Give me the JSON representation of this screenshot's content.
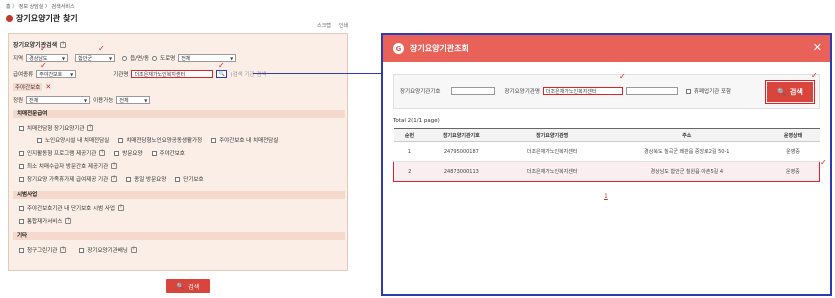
{
  "breadcrumb": "홈 〉 정보 상담실 〉 검색서비스",
  "page_title": "장기요양기관 찾기",
  "top_links": [
    "스크랩",
    "인쇄"
  ],
  "search_panel": {
    "section_title": "장기요양기관검색",
    "region_label": "지역",
    "province": "경상남도",
    "district": "함안군",
    "dong_label": "읍/면/동",
    "road_label": "도로명",
    "dong_value": "전체",
    "type_label": "급여종류",
    "type_value": "주야간보호",
    "name_label": "기관명",
    "name_value": "더조은재가노인복지센터",
    "name_hint": "(검색 기관 검색",
    "chip_label": "주야간보호",
    "capacity_label": "정원",
    "capacity_value": "전체",
    "availability_label": "이용가능",
    "availability_value": "전체",
    "dementia_head": "치매전문급여",
    "dementia_items": [
      "치매전담형 장기요양기관",
      "노인요양시설 내 치매전담실",
      "치매전담형노인요양공동생활가정",
      "주야간보호 내 치매전담실",
      "인지활동형 프로그램 제공기관",
      "방문요양",
      "주야간보호",
      "최소 치매수급자 방문간호 제공기관",
      "장기요양 가족휴가제 급여제공 기관",
      "종일 방문요양",
      "단기보호"
    ],
    "pilot_head": "시범사업",
    "pilot_items": [
      "주야간보호기관 내 단기보호 시범 사업",
      "통합재가서비스"
    ],
    "etc_head": "기타",
    "etc_items": [
      "청구그린기관",
      "장기요양기관배닝"
    ],
    "search_button": "검색"
  },
  "modal": {
    "title": "장기요양기관조회",
    "code_label": "장기요양기관기호",
    "name_label": "장기요양기관명",
    "name_value": "더조은재가노인복지센터",
    "closed_label": "휴폐업기관 포함",
    "search_button": "검색",
    "total": "Total 2(1/1 page)",
    "columns": [
      "순번",
      "장기요양기관기호",
      "장기요양기관명",
      "주소",
      "운영상태"
    ],
    "rows": [
      [
        "1",
        "24795000187",
        "더조은재가노인복지센터",
        "경상북도 칠곡군 왜관읍 중앙로2길 50-1",
        "운영중"
      ],
      [
        "2",
        "24873000113",
        "더조은재가노인복지센터",
        "경상남도 함안군 칠원읍 아촌5길 4",
        "운영중"
      ]
    ],
    "page": "1"
  }
}
